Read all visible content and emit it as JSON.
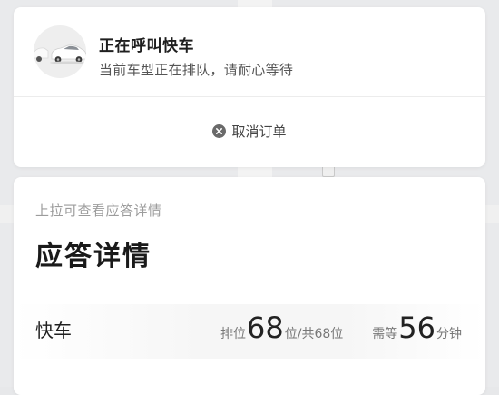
{
  "status_card": {
    "title": "正在呼叫快车",
    "subtitle": "当前车型正在排队，请耐心等待",
    "cancel_label": "取消订单"
  },
  "details_card": {
    "hint": "上拉可查看应答详情",
    "title": "应答详情",
    "car_type": "快车",
    "queue_prefix": "排位",
    "queue_position": "68",
    "queue_middle": "位/共",
    "queue_total": "68",
    "queue_suffix": "位",
    "wait_prefix": "需等",
    "wait_minutes": "56",
    "wait_suffix": "分钟"
  },
  "colors": {
    "background": "#e7e8ea",
    "card": "#ffffff",
    "muted_text": "#9c9c9c"
  },
  "icons": [
    "car-icon",
    "close-circle-icon"
  ]
}
